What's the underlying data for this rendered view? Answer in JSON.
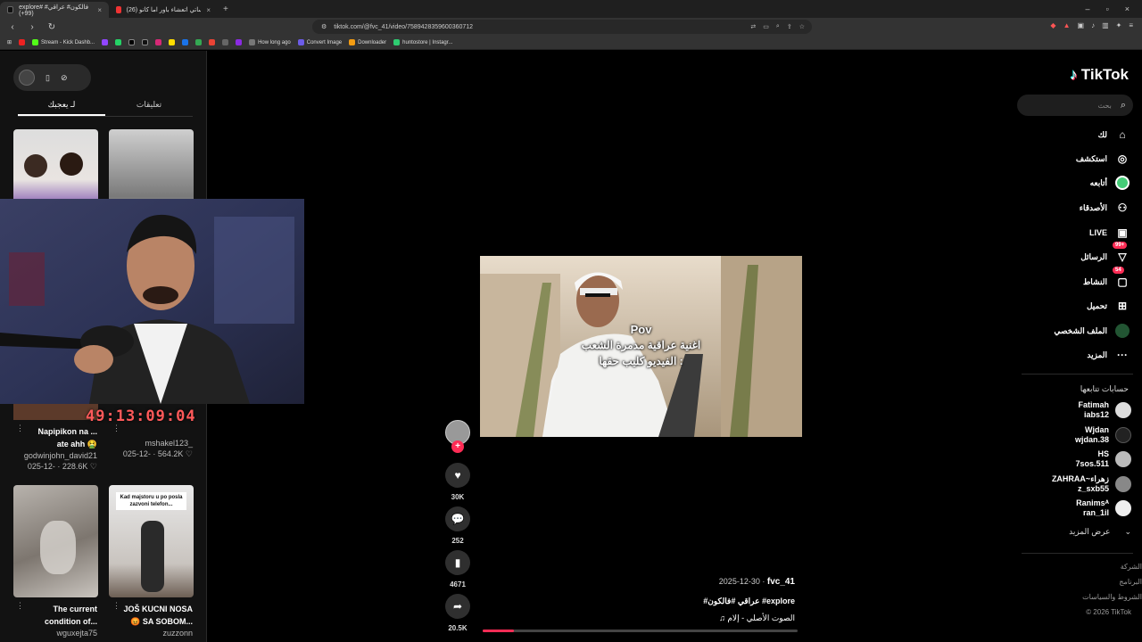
{
  "browser": {
    "tabs": [
      {
        "label": "explore# فالكون# عراقي# (99+)",
        "active": true
      },
      {
        "label": "(26) حقيقت اساتي اتعشاء باور اما كانو ...",
        "active": false
      }
    ],
    "new_tab": "+",
    "address": "tiktok.com/@fvc_41/video/7589428359600360712",
    "bookmarks": [
      "Stream - Kick Dashb...",
      "How long ago",
      "Convert Image",
      "Downloader",
      "huntostore | Instagr..."
    ]
  },
  "left_panel": {
    "tabs": [
      {
        "label": "لـ يعجبك",
        "active": true
      },
      {
        "label": "تعليقات",
        "active": false
      }
    ],
    "thumbs": [
      {
        "caption": "Napipikon na ...\nate ahh 🤮",
        "user": "godwinjohn_david21",
        "meta": "025-12- · 228.6K ♡"
      },
      {
        "caption": "...",
        "user": "mshakel123_",
        "meta": "025-12- · 564.2K ♡"
      },
      {
        "caption": "The current\ncondition of...",
        "user": "wguxejta75",
        "meta": ""
      },
      {
        "caption": "JOŠ KUCNI NOSA\n😡 SA SOBOM...",
        "user": "zuzzonn",
        "meta": ""
      }
    ],
    "thumb_overlay_text": "Kad majstoru u po posla zazvoni telefon...",
    "timer": "49:13:09:04"
  },
  "video": {
    "captions": [
      "Pov",
      "اغنية عراقية مدمرة الشعب",
      "الفيديو كليب حقها :"
    ],
    "likes": "30K",
    "comments": "252",
    "saves": "4671",
    "shares": "20.5K",
    "author": "fvc_41",
    "date": "2025-12-30",
    "hashtags": "#عراقي #فالكون #explore",
    "sound": "♫ الصوت الأصلي - إلام",
    "progress": 0.1
  },
  "right_nav": {
    "logo": "TikTok",
    "search_placeholder": "بحث",
    "items": [
      {
        "label": "لك",
        "icon": "home-icon",
        "glyph": "⌂"
      },
      {
        "label": "استكشف",
        "icon": "compass-icon",
        "glyph": "◎"
      },
      {
        "label": "أتابعه",
        "icon": "following-avatar-icon",
        "glyph": "●"
      },
      {
        "label": "الأصدقاء",
        "icon": "friends-icon",
        "glyph": "👥"
      },
      {
        "label": "LIVE",
        "icon": "live-icon",
        "glyph": "▣"
      },
      {
        "label": "الرسائل",
        "icon": "messages-icon",
        "glyph": "▽",
        "badge": "99+"
      },
      {
        "label": "النشاط",
        "icon": "activity-icon",
        "glyph": "▢",
        "badge": "54"
      },
      {
        "label": "تحميل",
        "icon": "upload-icon",
        "glyph": "⊞"
      },
      {
        "label": "الملف الشخصي",
        "icon": "profile-icon",
        "glyph": "●"
      },
      {
        "label": "المزيد",
        "icon": "more-icon",
        "glyph": "···"
      }
    ],
    "following_title": "حسابات تتابعها",
    "following": [
      {
        "name": "Fatimah",
        "handle": "iabs12"
      },
      {
        "name": "Wjdan",
        "handle": "wjdan.38"
      },
      {
        "name": "HS",
        "handle": "7sos.511"
      },
      {
        "name": "ZAHRAA~زهراء",
        "handle": "z_sxb55"
      },
      {
        "name": "Ranimsᴬ",
        "handle": "ran_1il"
      }
    ],
    "see_more": "عرض المزيد",
    "footer": [
      "الشركة",
      "البرنامج",
      "الشروط والسياسات",
      "© 2026 TikTok"
    ]
  }
}
